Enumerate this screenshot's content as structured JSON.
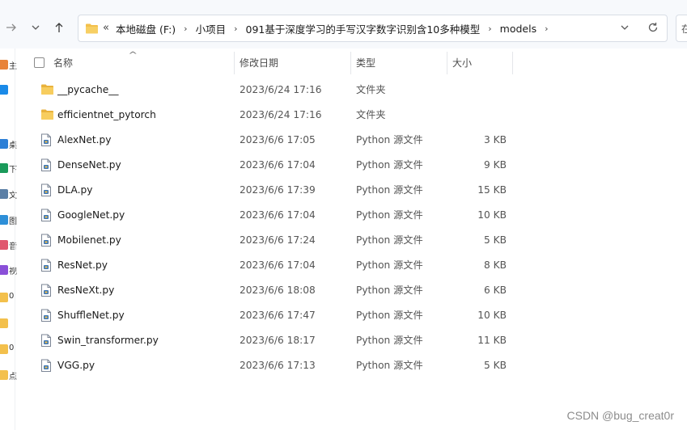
{
  "address_bar": {
    "overflow_glyph": "«",
    "breadcrumbs": [
      "本地磁盘 (F:)",
      "小项目",
      "091基于深度学习的手写汉字数字识别含10多种模型",
      "models"
    ],
    "separator": "›"
  },
  "search_stub_text": "在",
  "nav_pane": {
    "items": [
      {
        "icon": "home-icon",
        "color": "#e8833a",
        "label": "主"
      },
      {
        "icon": "cloud-icon",
        "color": "#1a8ae8",
        "label": ""
      },
      {
        "icon": "desktop-icon",
        "color": "#2c7fd6",
        "label": "桌"
      },
      {
        "icon": "download-icon",
        "color": "#1a9a5a",
        "label": "下"
      },
      {
        "icon": "documents-icon",
        "color": "#5b7fa6",
        "label": "文"
      },
      {
        "icon": "pictures-icon",
        "color": "#2d8fd8",
        "label": "图"
      },
      {
        "icon": "music-icon",
        "color": "#e0566e",
        "label": "音"
      },
      {
        "icon": "videos-icon",
        "color": "#8a4fd8",
        "label": "视"
      },
      {
        "icon": "folder-icon",
        "color": "#f3c04c",
        "label": "0"
      },
      {
        "icon": "folder-icon",
        "color": "#f3c04c",
        "label": ""
      },
      {
        "icon": "folder-icon",
        "color": "#f3c04c",
        "label": "0"
      },
      {
        "icon": "folder-icon",
        "color": "#f3c04c",
        "label": "点"
      }
    ]
  },
  "columns": {
    "name": "名称",
    "date": "修改日期",
    "type": "类型",
    "size": "大小"
  },
  "files": [
    {
      "name": "__pycache__",
      "date": "2023/6/24 17:16",
      "type": "文件夹",
      "size": "",
      "kind": "folder"
    },
    {
      "name": "efficientnet_pytorch",
      "date": "2023/6/24 17:16",
      "type": "文件夹",
      "size": "",
      "kind": "folder"
    },
    {
      "name": "AlexNet.py",
      "date": "2023/6/6 17:05",
      "type": "Python 源文件",
      "size": "3 KB",
      "kind": "py"
    },
    {
      "name": "DenseNet.py",
      "date": "2023/6/6 17:04",
      "type": "Python 源文件",
      "size": "9 KB",
      "kind": "py"
    },
    {
      "name": "DLA.py",
      "date": "2023/6/6 17:39",
      "type": "Python 源文件",
      "size": "15 KB",
      "kind": "py"
    },
    {
      "name": "GoogleNet.py",
      "date": "2023/6/6 17:04",
      "type": "Python 源文件",
      "size": "10 KB",
      "kind": "py"
    },
    {
      "name": "Mobilenet.py",
      "date": "2023/6/6 17:24",
      "type": "Python 源文件",
      "size": "5 KB",
      "kind": "py"
    },
    {
      "name": "ResNet.py",
      "date": "2023/6/6 17:04",
      "type": "Python 源文件",
      "size": "8 KB",
      "kind": "py"
    },
    {
      "name": "ResNeXt.py",
      "date": "2023/6/6 18:08",
      "type": "Python 源文件",
      "size": "6 KB",
      "kind": "py"
    },
    {
      "name": "ShuffleNet.py",
      "date": "2023/6/6 17:47",
      "type": "Python 源文件",
      "size": "10 KB",
      "kind": "py"
    },
    {
      "name": "Swin_transformer.py",
      "date": "2023/6/6 18:17",
      "type": "Python 源文件",
      "size": "11 KB",
      "kind": "py"
    },
    {
      "name": "VGG.py",
      "date": "2023/6/6 17:13",
      "type": "Python 源文件",
      "size": "5 KB",
      "kind": "py"
    }
  ],
  "watermark": "CSDN @bug_creat0r",
  "colors": {
    "folder": "#f3c04c",
    "folder_dark": "#e0a526",
    "py_accent": "#3a76b8"
  }
}
